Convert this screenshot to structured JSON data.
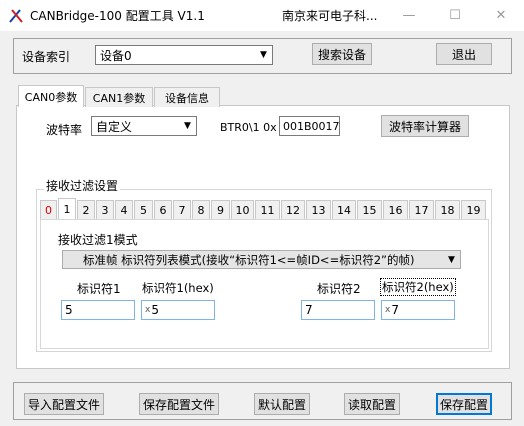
{
  "window": {
    "title": "CANBridge-100 配置工具 V1.1",
    "company": "南京来可电子科...",
    "minimize_glyph": "—",
    "maximize_glyph": "☐",
    "close_glyph": "✕"
  },
  "device": {
    "label": "设备索引",
    "selected": "设备0",
    "search_button": "搜索设备",
    "exit_button": "退出"
  },
  "tabs": [
    "CAN0参数",
    "CAN1参数",
    "设备信息"
  ],
  "can0": {
    "baud_label": "波特率",
    "baud_value": "自定义",
    "btr_label": "BTR0\\1 0x",
    "btr_value": "001B0017",
    "baud_calc_button": "波特率计算器",
    "filter_group_label": "接收过滤设置",
    "filter_tabs": [
      "0",
      "1",
      "2",
      "3",
      "4",
      "5",
      "6",
      "7",
      "8",
      "9",
      "10",
      "11",
      "12",
      "13",
      "14",
      "15",
      "16",
      "17",
      "18",
      "19"
    ],
    "filter_mode_label": "接收过滤1模式",
    "filter_mode_value": "标准帧 标识符列表模式(接收“标识符1<=帧ID<=标识符2”的帧)",
    "id1_label": "标识符1",
    "id1_hex_label": "标识符1(hex)",
    "id2_label": "标识符2",
    "id2_hex_label": "标识符2(hex)",
    "id1_value": "5",
    "id1_hex_value": "5",
    "id2_value": "7",
    "id2_hex_value": "7",
    "hex_prefix": "x"
  },
  "bottom": {
    "import_button": "导入配置文件",
    "save_file_button": "保存配置文件",
    "default_button": "默认配置",
    "read_button": "读取配置",
    "save_button": "保存配置"
  },
  "colors": {
    "accent": "#0078d7",
    "active_filter_tab_text": "#e00000"
  }
}
